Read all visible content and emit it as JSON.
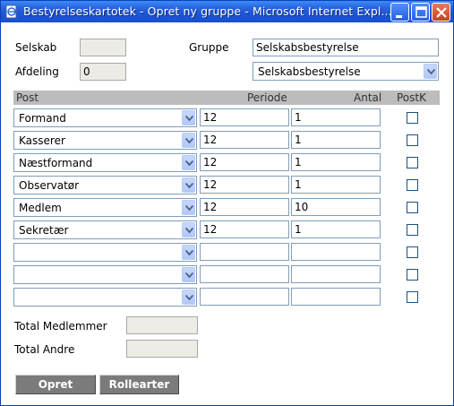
{
  "window": {
    "title": "Bestyrelseskartotek - Opret ny gruppe - Microsoft Internet Expl...",
    "colors": {
      "titlebar": "#1d55d6",
      "header_bg": "#bcbcbc",
      "button_bg": "#7b7b7b"
    }
  },
  "form": {
    "selskab_label": "Selskab",
    "selskab_value": "",
    "afdeling_label": "Afdeling",
    "afdeling_value": "0",
    "gruppe_label": "Gruppe",
    "gruppe_value": "Selskabsbestyrelse",
    "gruppe_select": "Selskabsbestyrelse"
  },
  "table": {
    "headers": {
      "post": "Post",
      "periode": "Periode",
      "antal": "Antal",
      "postk": "PostK"
    },
    "rows": [
      {
        "post": "Formand",
        "periode": "12",
        "antal": "1"
      },
      {
        "post": "Kasserer",
        "periode": "12",
        "antal": "1"
      },
      {
        "post": "Næstformand",
        "periode": "12",
        "antal": "1"
      },
      {
        "post": "Observatør",
        "periode": "12",
        "antal": "1"
      },
      {
        "post": "Medlem",
        "periode": "12",
        "antal": "10"
      },
      {
        "post": "Sekretær",
        "periode": "12",
        "antal": "1"
      },
      {
        "post": "",
        "periode": "",
        "antal": ""
      },
      {
        "post": "",
        "periode": "",
        "antal": ""
      },
      {
        "post": "",
        "periode": "",
        "antal": ""
      }
    ]
  },
  "totals": {
    "medlemmer_label": "Total Medlemmer",
    "medlemmer_value": "",
    "andre_label": "Total Andre",
    "andre_value": ""
  },
  "buttons": {
    "opret": "Opret",
    "rollearter": "Rollearter"
  }
}
